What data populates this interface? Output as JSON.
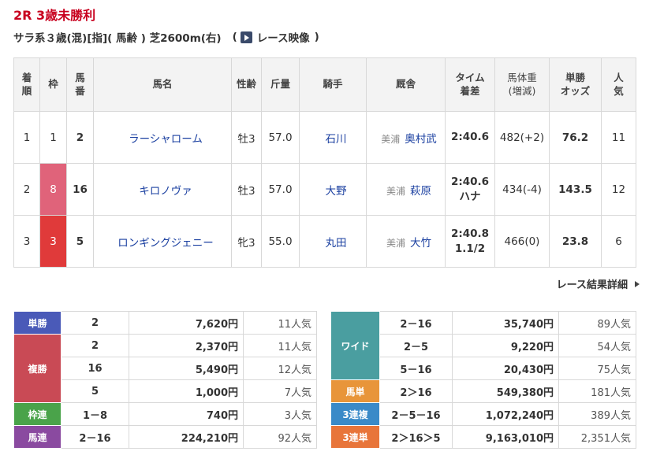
{
  "race": {
    "title": "2R 3歳未勝利",
    "conditions": "サラ系３歳(混)[指]( 馬齢 ) 芝2600m(右)",
    "paren_open": "(",
    "paren_close": ")",
    "video_label": "レース映像",
    "video_icon": "play-icon"
  },
  "result_table": {
    "headers": {
      "rank": "着\n順",
      "frame": "枠",
      "number": "馬\n番",
      "horse": "馬名",
      "sex_age": "性齢",
      "weight": "斤量",
      "jockey": "騎手",
      "trainer": "厩舎",
      "time": "タイム\n着差",
      "body_weight": "馬体重\n(増減)",
      "odds": "単勝\nオッズ",
      "popularity": "人\n気"
    },
    "rows": [
      {
        "rank": "1",
        "frame": "1",
        "number": "2",
        "horse": "ラーシャローム",
        "sex_age": "牡3",
        "weight": "57.0",
        "jockey": "石川",
        "region": "美浦",
        "trainer": "奥村武",
        "time": "2:40.6",
        "margin": "",
        "body_weight": "482(+2)",
        "odds": "76.2",
        "popularity": "11"
      },
      {
        "rank": "2",
        "frame": "8",
        "number": "16",
        "horse": "キロノヴァ",
        "sex_age": "牡3",
        "weight": "57.0",
        "jockey": "大野",
        "region": "美浦",
        "trainer": "萩原",
        "time": "2:40.6",
        "margin": "ハナ",
        "body_weight": "434(-4)",
        "odds": "143.5",
        "popularity": "12"
      },
      {
        "rank": "3",
        "frame": "3",
        "number": "5",
        "horse": "ロンギングジェニー",
        "sex_age": "牝3",
        "weight": "55.0",
        "jockey": "丸田",
        "region": "美浦",
        "trainer": "大竹",
        "time": "2:40.8",
        "margin": "1.1/2",
        "body_weight": "466(0)",
        "odds": "23.8",
        "popularity": "6"
      }
    ]
  },
  "detail_link": "レース結果詳細",
  "payouts_left": {
    "tansho": {
      "label": "単勝",
      "entries": [
        {
          "combo": "2",
          "amount": "7,620円",
          "pop": "11人気"
        }
      ]
    },
    "fukusho": {
      "label": "複勝",
      "entries": [
        {
          "combo": "2",
          "amount": "2,370円",
          "pop": "11人気"
        },
        {
          "combo": "16",
          "amount": "5,490円",
          "pop": "12人気"
        },
        {
          "combo": "5",
          "amount": "1,000円",
          "pop": "7人気"
        }
      ]
    },
    "wakuren": {
      "label": "枠連",
      "entries": [
        {
          "combo": "1－8",
          "amount": "740円",
          "pop": "3人気"
        }
      ]
    },
    "umaren": {
      "label": "馬連",
      "entries": [
        {
          "combo": "2－16",
          "amount": "224,210円",
          "pop": "92人気"
        }
      ]
    }
  },
  "payouts_right": {
    "wide": {
      "label": "ワイド",
      "entries": [
        {
          "combo": "2－16",
          "amount": "35,740円",
          "pop": "89人気"
        },
        {
          "combo": "2－5",
          "amount": "9,220円",
          "pop": "54人気"
        },
        {
          "combo": "5－16",
          "amount": "20,430円",
          "pop": "75人気"
        }
      ]
    },
    "umatan": {
      "label": "馬単",
      "entries": [
        {
          "combo": "2＞16",
          "amount": "549,380円",
          "pop": "181人気"
        }
      ]
    },
    "sanrenpuku": {
      "label": "3連複",
      "entries": [
        {
          "combo": "2－5－16",
          "amount": "1,072,240円",
          "pop": "389人気"
        }
      ]
    },
    "sanrentan": {
      "label": "3連単",
      "entries": [
        {
          "combo": "2＞16＞5",
          "amount": "9,163,010円",
          "pop": "2,351人気"
        }
      ]
    }
  },
  "colors": {
    "title_red": "#c8001e",
    "link_blue": "#1a3fa0",
    "frame_8": "#e0637a",
    "frame_3": "#e03a3a",
    "tansho": "#4a5ab8",
    "fukusho": "#c94a55",
    "wakuren": "#4aa34a",
    "umaren": "#8a4aa0",
    "wide": "#4a9ea0",
    "umatan": "#e8953a",
    "sanrenpuku": "#3a8ac8",
    "sanrentan": "#e8753a"
  }
}
